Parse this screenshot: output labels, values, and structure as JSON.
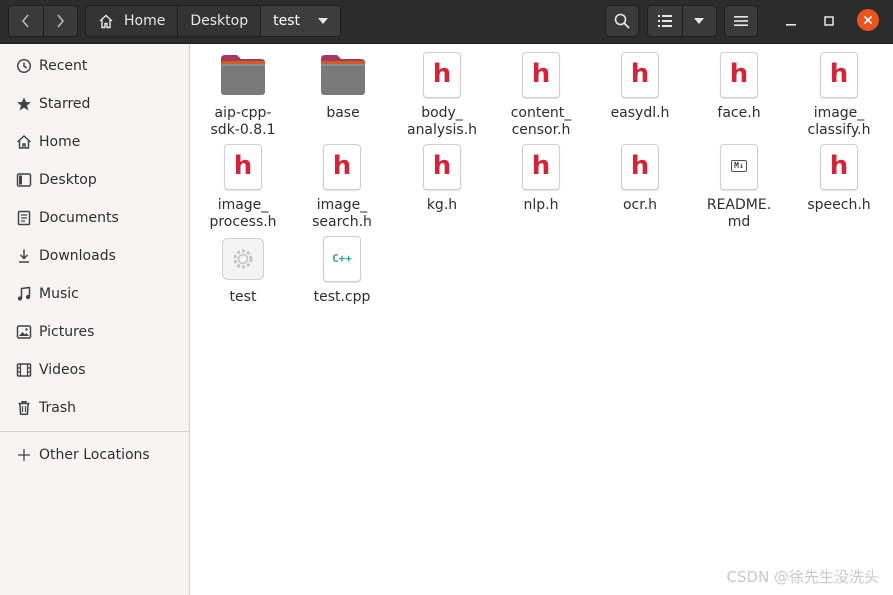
{
  "header": {
    "breadcrumbs": [
      {
        "label": "Home",
        "icon": "home-icon"
      },
      {
        "label": "Desktop"
      },
      {
        "label": "test"
      }
    ]
  },
  "sidebar": {
    "items": [
      {
        "label": "Recent",
        "icon": "clock-icon"
      },
      {
        "label": "Starred",
        "icon": "star-icon"
      },
      {
        "label": "Home",
        "icon": "home-icon"
      },
      {
        "label": "Desktop",
        "icon": "desktop-icon"
      },
      {
        "label": "Documents",
        "icon": "document-icon"
      },
      {
        "label": "Downloads",
        "icon": "download-icon"
      },
      {
        "label": "Music",
        "icon": "music-icon"
      },
      {
        "label": "Pictures",
        "icon": "picture-icon"
      },
      {
        "label": "Videos",
        "icon": "video-icon"
      },
      {
        "label": "Trash",
        "icon": "trash-icon"
      }
    ],
    "other_locations": {
      "label": "Other Locations",
      "icon": "plus-icon"
    }
  },
  "files": [
    {
      "name": "aip-cpp-\nsdk-0.8.1",
      "type": "folder"
    },
    {
      "name": "base",
      "type": "folder"
    },
    {
      "name": "body_\nanalysis.h",
      "type": "header",
      "glyph": "h"
    },
    {
      "name": "content_\ncensor.h",
      "type": "header",
      "glyph": "h"
    },
    {
      "name": "easydl.h",
      "type": "header",
      "glyph": "h"
    },
    {
      "name": "face.h",
      "type": "header",
      "glyph": "h"
    },
    {
      "name": "image_\nclassify.h",
      "type": "header",
      "glyph": "h"
    },
    {
      "name": "image_\nprocess.h",
      "type": "header",
      "glyph": "h"
    },
    {
      "name": "image_\nsearch.h",
      "type": "header",
      "glyph": "h"
    },
    {
      "name": "kg.h",
      "type": "header",
      "glyph": "h"
    },
    {
      "name": "nlp.h",
      "type": "header",
      "glyph": "h"
    },
    {
      "name": "ocr.h",
      "type": "header",
      "glyph": "h"
    },
    {
      "name": "README.\nmd",
      "type": "markdown",
      "glyph": "M↓"
    },
    {
      "name": "speech.h",
      "type": "header",
      "glyph": "h"
    },
    {
      "name": "test",
      "type": "executable"
    },
    {
      "name": "test.cpp",
      "type": "cpp",
      "glyph": "C++"
    }
  ],
  "watermark": "CSDN @徐先生没洗头",
  "colors": {
    "headerbar": "#2c2c2c",
    "sidebar": "#f6f5f4",
    "close_button": "#e95420",
    "header_glyph": "#d0253a",
    "folder_top": "#a33a5e"
  }
}
